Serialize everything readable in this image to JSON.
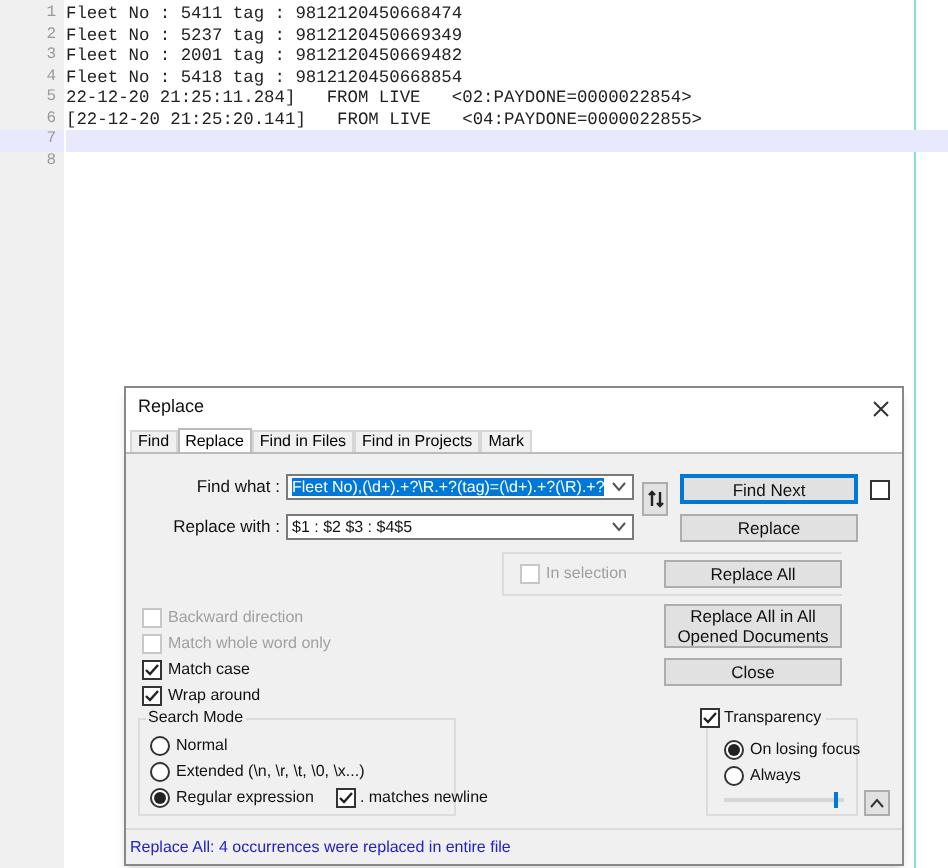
{
  "editor": {
    "lines": [
      {
        "number": "1",
        "text": "Fleet No : 5411 tag : 9812120450668474",
        "current": false
      },
      {
        "number": "2",
        "text": "Fleet No : 5237 tag : 9812120450669349",
        "current": false
      },
      {
        "number": "3",
        "text": "Fleet No : 2001 tag : 9812120450669482",
        "current": false
      },
      {
        "number": "4",
        "text": "Fleet No : 5418 tag : 9812120450668854",
        "current": false
      },
      {
        "number": "5",
        "text": "22-12-20 21:25:11.284]   FROM LIVE   <02:PAYDONE=0000022854>",
        "current": false
      },
      {
        "number": "6",
        "text": "[22-12-20 21:25:20.141]   FROM LIVE   <04:PAYDONE=0000022855>",
        "current": false
      },
      {
        "number": "7",
        "current": true
      },
      {
        "number": "8",
        "current": false
      }
    ]
  },
  "dialog": {
    "title": "Replace",
    "tabs": [
      {
        "label": "Find",
        "selected": false
      },
      {
        "label": "Replace",
        "selected": true
      },
      {
        "label": "Find in Files",
        "selected": false
      },
      {
        "label": "Find in Projects",
        "selected": false
      },
      {
        "label": "Mark",
        "selected": false
      }
    ],
    "find_what": {
      "label": "Find what :",
      "value": "Fleet No),(\\d+).+?\\R.+?(tag)=(\\d+).+?(\\R).+?",
      "selected": true
    },
    "replace_with": {
      "label": "Replace with :",
      "value": "$1 : $2 $3 : $4$5",
      "selected": false
    },
    "buttons": [
      {
        "label": "Find Next",
        "default": true
      },
      {
        "label": "Replace",
        "default": false
      }
    ],
    "find_next_checkbox": {
      "checked": false
    },
    "in_selection": {
      "label": "In selection",
      "checked": false,
      "disabled": true
    },
    "replace_all": {
      "label": "Replace All"
    },
    "replace_all_opened": {
      "label": "Replace All in All Opened Documents"
    },
    "close": {
      "label": "Close"
    },
    "options": [
      {
        "label": "Backward direction",
        "checked": false,
        "disabled": true
      },
      {
        "label": "Match whole word only",
        "checked": false,
        "disabled": true
      },
      {
        "label": "Match case",
        "checked": true,
        "disabled": false
      },
      {
        "label": "Wrap around",
        "checked": true,
        "disabled": false
      }
    ],
    "search_mode": {
      "title": "Search Mode",
      "options": [
        {
          "label": "Normal",
          "selected": false
        },
        {
          "label": "Extended (\\n, \\r, \\t, \\0, \\x...)",
          "selected": false
        },
        {
          "label": "Regular expression",
          "selected": true
        }
      ],
      "dot_newline": {
        "label": ". matches newline",
        "checked": true
      }
    },
    "transparency": {
      "label": "Transparency",
      "checked": true,
      "options": [
        {
          "label": "On losing focus",
          "selected": true
        },
        {
          "label": "Always",
          "selected": false
        }
      ],
      "level": 0.95
    },
    "status": "Replace All: 4 occurrences were replaced in entire file"
  }
}
